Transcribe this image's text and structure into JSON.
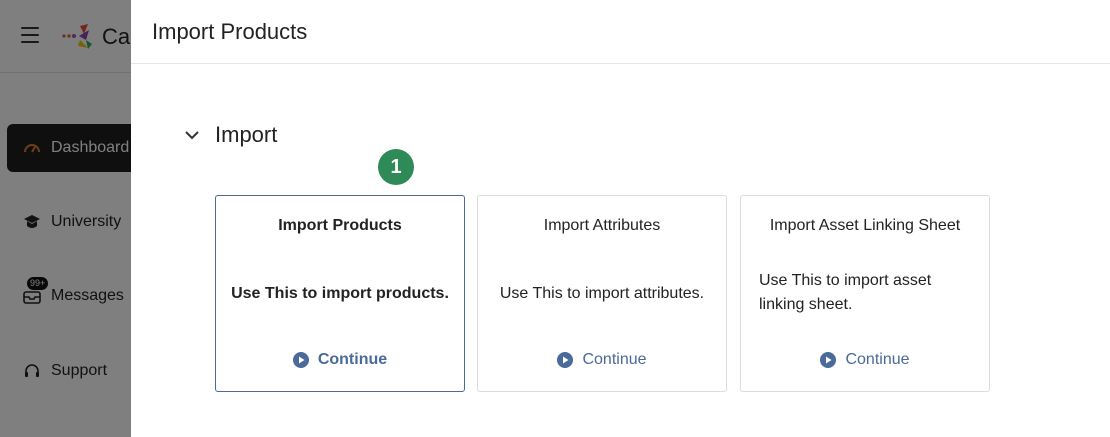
{
  "app": {
    "brand_text": "Ca",
    "sidebar": [
      {
        "label": "Dashboard"
      },
      {
        "label": "University"
      },
      {
        "label": "Messages",
        "badge": "99+"
      },
      {
        "label": "Support"
      }
    ]
  },
  "drawer": {
    "title": "Import Products",
    "section_title": "Import",
    "step_number": "1",
    "continue_label": "Continue",
    "cards": [
      {
        "title": "Import Products",
        "description": "Use This to import products."
      },
      {
        "title": "Import Attributes",
        "description": "Use This to import attributes."
      },
      {
        "title": "Import Asset Linking Sheet",
        "description": "Use This to import asset linking sheet."
      }
    ]
  },
  "colors": {
    "step_badge": "#2e8b57",
    "link": "#4a6a9a",
    "active_nav": "#1f1f1f"
  }
}
